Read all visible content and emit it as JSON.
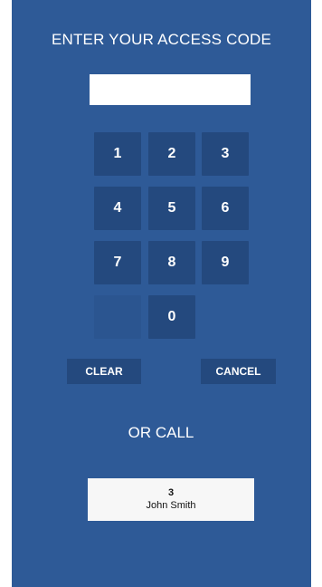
{
  "header": {
    "title": "ENTER YOUR ACCESS CODE"
  },
  "code_input": {
    "value": "",
    "placeholder": ""
  },
  "keypad": {
    "keys": [
      "1",
      "2",
      "3",
      "4",
      "5",
      "6",
      "7",
      "8",
      "9",
      "0"
    ]
  },
  "actions": {
    "clear_label": "CLEAR",
    "cancel_label": "CANCEL"
  },
  "call_section": {
    "label": "OR CALL",
    "contact_number": "3",
    "contact_name": "John Smith"
  },
  "colors": {
    "background": "#2e5a97",
    "key_background": "#24497e",
    "text": "#ffffff"
  }
}
